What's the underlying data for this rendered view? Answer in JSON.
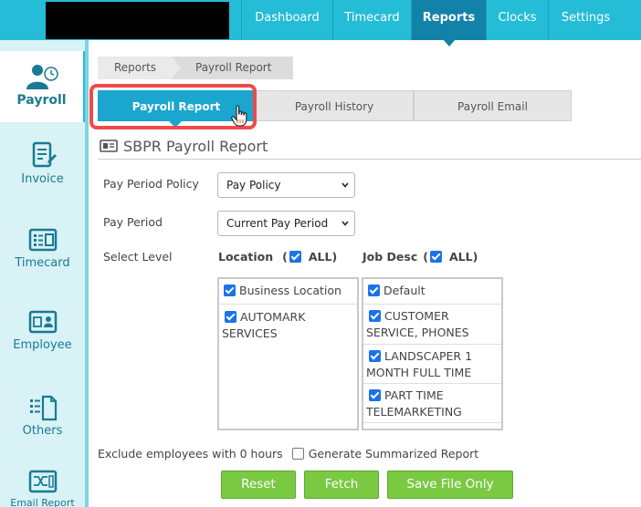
{
  "topnav": {
    "items": [
      {
        "label": "Dashboard"
      },
      {
        "label": "Timecard"
      },
      {
        "label": "Reports"
      },
      {
        "label": "Clocks"
      },
      {
        "label": "Settings"
      }
    ],
    "active": "Reports"
  },
  "sidebar": {
    "items": [
      {
        "label": "Payroll",
        "icon": "person-clock-icon"
      },
      {
        "label": "Invoice",
        "icon": "invoice-icon"
      },
      {
        "label": "Timecard",
        "icon": "timecard-icon"
      },
      {
        "label": "Employee",
        "icon": "employee-card-icon"
      },
      {
        "label": "Others",
        "icon": "document-list-icon"
      },
      {
        "label": "Email Report",
        "icon": "email-report-icon"
      }
    ],
    "active": "Payroll"
  },
  "breadcrumb": [
    "Reports",
    "Payroll Report"
  ],
  "tabs": [
    {
      "label": "Payroll Report"
    },
    {
      "label": "Payroll History"
    },
    {
      "label": "Payroll Email"
    }
  ],
  "section_title": "SBPR Payroll Report",
  "form": {
    "pay_period_policy_label": "Pay Period Policy",
    "pay_period_policy_value": "Pay Policy",
    "pay_period_label": "Pay Period",
    "pay_period_value": "Current Pay Period",
    "select_level_label": "Select Level",
    "location_head": "Location",
    "location_all": "ALL)",
    "location_paren": "(",
    "job_head": "Job Desc",
    "job_all": "ALL)",
    "job_paren": "(",
    "locations": [
      "Business Location",
      "AUTOMARK SERVICES"
    ],
    "jobs": [
      "Default",
      "CUSTOMER SERVICE, PHONES",
      "LANDSCAPER 1 MONTH FULL TIME",
      "PART TIME TELEMARKETING"
    ],
    "exclude_label": "Exclude employees with 0 hours",
    "summarized_label": "Generate Summarized Report"
  },
  "buttons": {
    "reset": "Reset",
    "fetch": "Fetch",
    "save": "Save File Only"
  },
  "colors": {
    "topbar": "#24bcd6",
    "active_nav": "#1282a8",
    "active_tab": "#1aa6cf",
    "highlight": "#ef4a4a",
    "button_green": "#7ac943"
  }
}
